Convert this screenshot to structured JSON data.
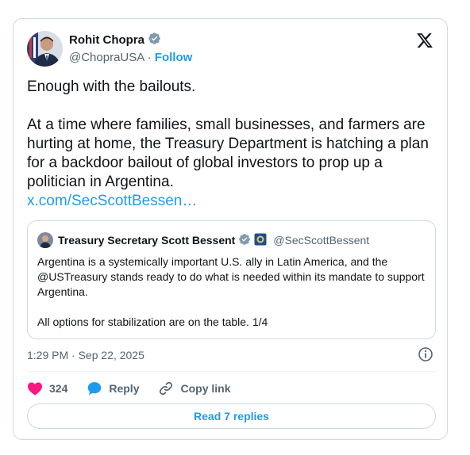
{
  "author": {
    "name": "Rohit Chopra",
    "handle": "@ChopraUSA",
    "separator": "·",
    "follow_label": "Follow"
  },
  "tweet": {
    "line1": "Enough with the bailouts.",
    "paragraph2": "At a time where families, small businesses, and farmers are hurting at home, the Treasury Department is hatching a plan for a backdoor bailout of global investors to prop up a politician in Argentina.",
    "link_text": "x.com/SecScottBessen…"
  },
  "quoted_tweet": {
    "name": "Treasury Secretary Scott Bessent",
    "handle": "@SecScottBessent",
    "paragraph1": "Argentina is a systemically important U.S. ally in Latin America, and the @USTreasury stands ready to do what is needed within its mandate to support Argentina.",
    "paragraph2": "All options for stabilization are on the table. 1/4"
  },
  "meta": {
    "timestamp": "1:29 PM · Sep 22, 2025"
  },
  "actions": {
    "likes_count": "324",
    "reply_label": "Reply",
    "copy_link_label": "Copy link"
  },
  "footer": {
    "read_replies_label": "Read 7 replies"
  },
  "colors": {
    "accent": "#1d9bf0",
    "like": "#f91880",
    "secondary_text": "#536471",
    "border": "#cfd9de",
    "verified_gray": "#829aab"
  },
  "icons": {
    "brand": "x-logo-icon",
    "verified": "verified-badge-icon",
    "government_flag": "treasury-seal-icon",
    "info": "info-icon",
    "like": "heart-icon",
    "reply": "speech-bubble-icon",
    "copy_link": "link-icon"
  }
}
